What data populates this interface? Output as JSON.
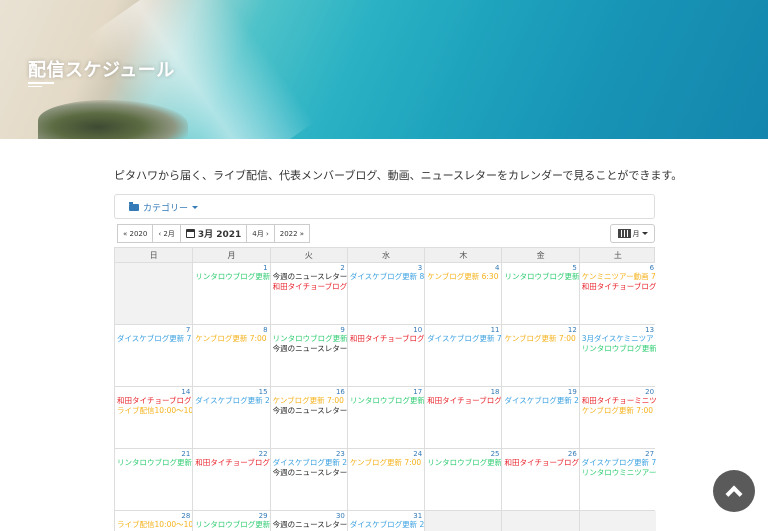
{
  "hero": {
    "title": "配信スケジュール"
  },
  "intro": "ピタハワから届く、ライブ配信、代表メンバーブログ、動画、ニュースレターをカレンダーで見ることができます。",
  "category": {
    "label": "カテゴリー"
  },
  "nav": {
    "prev_year": "« 2020",
    "prev_month": "‹ 2月",
    "current": "3月 2021",
    "next_month": "4月 ›",
    "next_year": "2022 »",
    "view_label": "月"
  },
  "weekdays": [
    "日",
    "月",
    "火",
    "水",
    "木",
    "金",
    "土"
  ],
  "colors": {
    "green": "#2ecc71",
    "blue": "#3aa0e0",
    "orange": "#f5b21b",
    "red": "#e8222a",
    "black": "#222222",
    "pink": "#f08080"
  },
  "weeks": [
    [
      {
        "day": "",
        "events": []
      },
      {
        "day": "1",
        "events": [
          {
            "text": "リンタロウブログ更新 7",
            "color": "green"
          }
        ]
      },
      {
        "day": "2",
        "events": [
          {
            "text": "今週のニュースレター",
            "color": "black"
          },
          {
            "text": "和田タイチョーブログ",
            "color": "red"
          }
        ]
      },
      {
        "day": "3",
        "events": [
          {
            "text": "ダイスケブログ更新 8",
            "color": "blue"
          }
        ]
      },
      {
        "day": "4",
        "events": [
          {
            "text": "ケンブログ更新 6:30 ",
            "color": "orange"
          }
        ]
      },
      {
        "day": "5",
        "events": [
          {
            "text": "リンタロウブログ更新",
            "color": "green"
          }
        ]
      },
      {
        "day": "6",
        "events": [
          {
            "text": "ケンミニツアー動画 7",
            "color": "orange"
          },
          {
            "text": "和田タイチョーブログ",
            "color": "red"
          }
        ]
      }
    ],
    [
      {
        "day": "7",
        "events": [
          {
            "text": "ダイスケブログ更新 7",
            "color": "blue"
          }
        ]
      },
      {
        "day": "8",
        "events": [
          {
            "text": "ケンブログ更新 7:00 ",
            "color": "orange"
          }
        ]
      },
      {
        "day": "9",
        "events": [
          {
            "text": "リンタロウブログ更新",
            "color": "green"
          },
          {
            "text": "今週のニュースレター",
            "color": "black"
          }
        ]
      },
      {
        "day": "10",
        "events": [
          {
            "text": "和田タイチョーブログ",
            "color": "red"
          }
        ]
      },
      {
        "day": "11",
        "events": [
          {
            "text": "ダイスケブログ更新 7",
            "color": "blue"
          }
        ]
      },
      {
        "day": "12",
        "events": [
          {
            "text": "ケンブログ更新 7:00 ",
            "color": "orange"
          }
        ]
      },
      {
        "day": "13",
        "events": [
          {
            "text": "3月ダイスケミニツア",
            "color": "blue"
          },
          {
            "text": "リンタロウブログ更新",
            "color": "green"
          }
        ]
      }
    ],
    [
      {
        "day": "14",
        "events": [
          {
            "text": "和田タイチョーブログ",
            "color": "red"
          },
          {
            "text": "ライブ配信10:00～10",
            "color": "orange"
          }
        ]
      },
      {
        "day": "15",
        "events": [
          {
            "text": "ダイスケブログ更新 2",
            "color": "blue"
          }
        ]
      },
      {
        "day": "16",
        "events": [
          {
            "text": "ケンブログ更新 7:00 ",
            "color": "orange"
          },
          {
            "text": "今週のニュースレター",
            "color": "black"
          }
        ]
      },
      {
        "day": "17",
        "events": [
          {
            "text": "リンタロウブログ更新",
            "color": "green"
          }
        ]
      },
      {
        "day": "18",
        "events": [
          {
            "text": "和田タイチョーブログ",
            "color": "red"
          }
        ]
      },
      {
        "day": "19",
        "events": [
          {
            "text": "ダイスケブログ更新 2",
            "color": "blue"
          }
        ]
      },
      {
        "day": "20",
        "events": [
          {
            "text": "和田タイチョーミニツ",
            "color": "red"
          },
          {
            "text": "ケンブログ更新 7:00 ",
            "color": "orange"
          }
        ]
      }
    ],
    [
      {
        "day": "21",
        "events": [
          {
            "text": "リンタロウブログ更新",
            "color": "green"
          }
        ]
      },
      {
        "day": "22",
        "events": [
          {
            "text": "和田タイチョーブログ",
            "color": "red"
          }
        ]
      },
      {
        "day": "23",
        "events": [
          {
            "text": "ダイスケブログ更新 2",
            "color": "blue"
          },
          {
            "text": "今週のニュースレター",
            "color": "black"
          }
        ]
      },
      {
        "day": "24",
        "events": [
          {
            "text": "ケンブログ更新 7:00 ",
            "color": "orange"
          }
        ]
      },
      {
        "day": "25",
        "events": [
          {
            "text": "リンタロウブログ更新",
            "color": "green"
          }
        ]
      },
      {
        "day": "26",
        "events": [
          {
            "text": "和田タイチョーブログ",
            "color": "red"
          }
        ]
      },
      {
        "day": "27",
        "events": [
          {
            "text": "ダイスケブログ更新 7",
            "color": "blue"
          },
          {
            "text": "リンタロウミニツアー",
            "color": "green"
          }
        ]
      }
    ],
    [
      {
        "day": "28",
        "events": [
          {
            "text": "ライブ配信10:00～10",
            "color": "orange"
          }
        ]
      },
      {
        "day": "29",
        "events": [
          {
            "text": "リンタロウブログ更新",
            "color": "green"
          }
        ]
      },
      {
        "day": "30",
        "events": [
          {
            "text": "今週のニュースレター",
            "color": "black"
          }
        ]
      },
      {
        "day": "31",
        "events": [
          {
            "text": "ダイスケブログ更新 2",
            "color": "blue"
          }
        ]
      },
      {
        "day": "",
        "events": []
      },
      {
        "day": "",
        "events": []
      },
      {
        "day": "",
        "events": []
      }
    ]
  ]
}
